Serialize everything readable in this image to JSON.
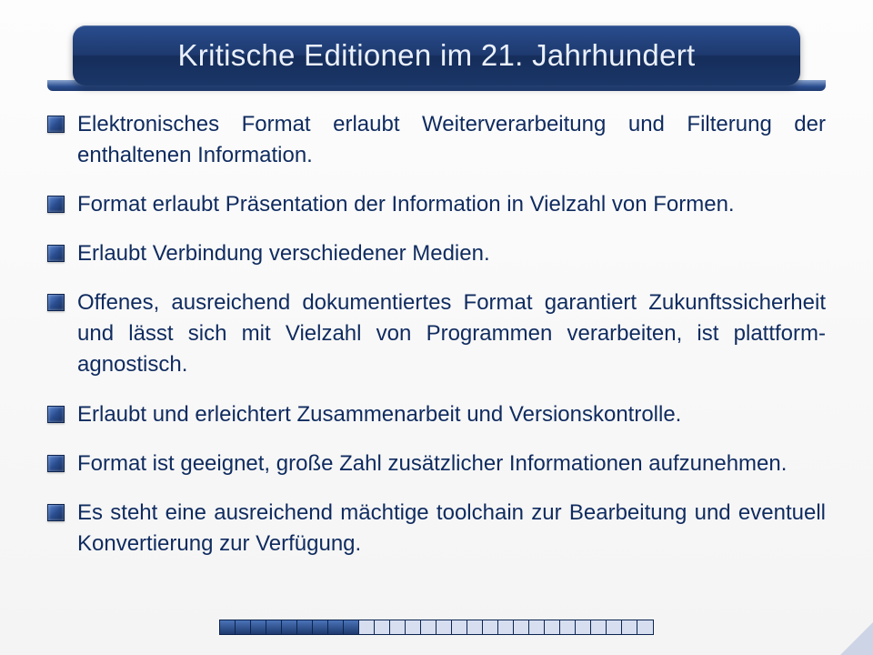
{
  "title": "Kritische Editionen im 21. Jahrhundert",
  "bullets": [
    "Elektronisches Format erlaubt Weiterverarbeitung und Filterung der enthaltenen Information.",
    "Format erlaubt Präsentation der Information in Vielzahl von Formen.",
    "Erlaubt Verbindung verschiedener Medien.",
    "Offenes, ausreichend dokumentiertes Format garantiert Zukunftssicherheit und lässt sich mit Vielzahl von Programmen verarbeiten, ist plattform-agnostisch.",
    "Erlaubt und erleichtert Zusammenarbeit und Versionskontrolle.",
    "Format ist geeignet, große Zahl zusätzlicher Informationen aufzunehmen.",
    "Es steht eine ausreichend mächtige toolchain zur Bearbeitung und eventuell Konvertierung zur Verfügung."
  ],
  "progress": {
    "filled": 9,
    "total": 28
  }
}
